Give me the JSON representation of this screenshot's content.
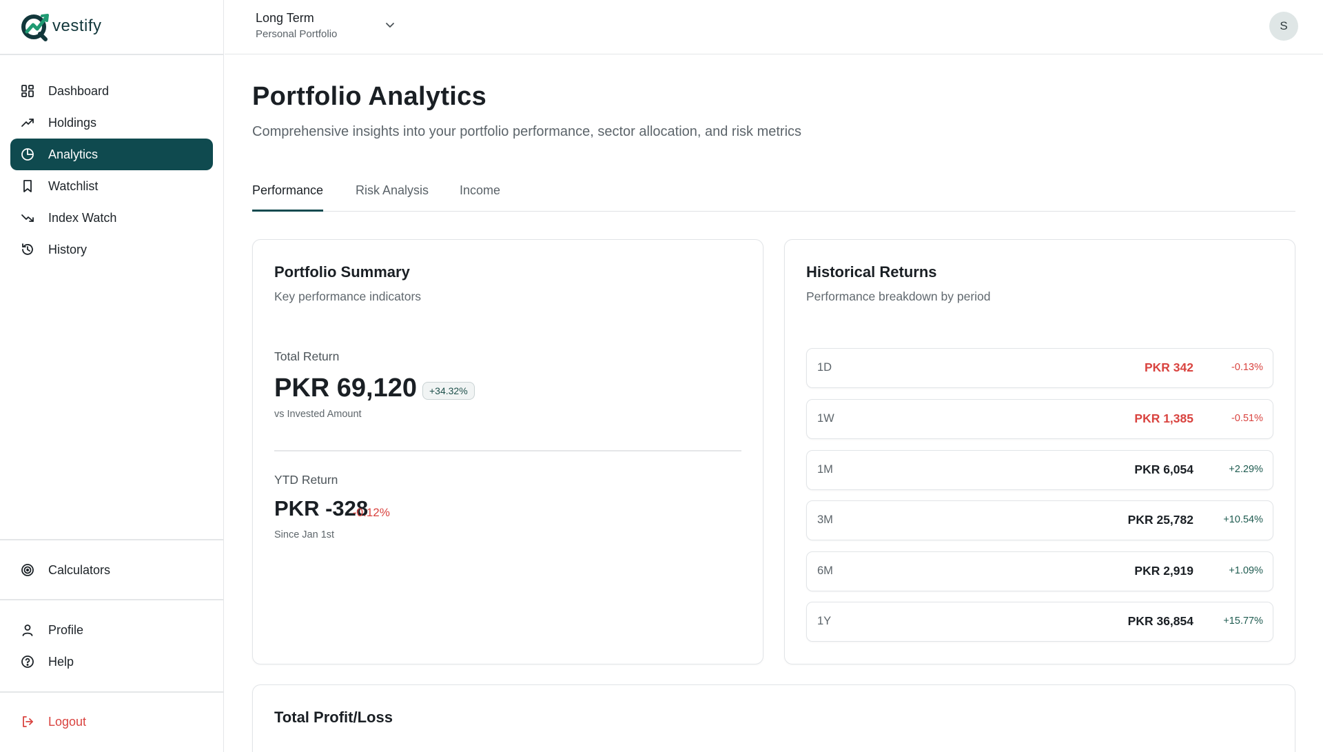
{
  "brand": {
    "name": "vestify",
    "primary": "#0f4a4f",
    "negative": "#d9433f",
    "positive": "#1d5a4f"
  },
  "sidebar": {
    "main_items": [
      {
        "label": "Dashboard",
        "icon": "dashboard-icon"
      },
      {
        "label": "Holdings",
        "icon": "trending-up-icon"
      },
      {
        "label": "Analytics",
        "icon": "pie-chart-icon",
        "active": true
      },
      {
        "label": "Watchlist",
        "icon": "bookmark-icon"
      },
      {
        "label": "Index Watch",
        "icon": "trending-down-icon"
      },
      {
        "label": "History",
        "icon": "history-icon"
      }
    ],
    "tools_items": [
      {
        "label": "Calculators",
        "icon": "target-icon"
      }
    ],
    "account_items": [
      {
        "label": "Profile",
        "icon": "user-icon"
      },
      {
        "label": "Help",
        "icon": "help-circle-icon"
      }
    ],
    "logout": {
      "label": "Logout",
      "icon": "logout-icon"
    }
  },
  "header": {
    "portfolio_name": "Long Term",
    "portfolio_type": "Personal Portfolio",
    "avatar_initial": "S"
  },
  "page": {
    "title": "Portfolio Analytics",
    "subtitle": "Comprehensive insights into your portfolio performance, sector allocation, and risk metrics",
    "tabs": [
      {
        "label": "Performance",
        "active": true
      },
      {
        "label": "Risk Analysis"
      },
      {
        "label": "Income"
      }
    ]
  },
  "summary": {
    "title": "Portfolio Summary",
    "subtitle": "Key performance indicators",
    "total_return": {
      "label": "Total Return",
      "value": "PKR 69,120",
      "pct": "+34.32%",
      "note": "vs Invested Amount"
    },
    "ytd_return": {
      "label": "YTD Return",
      "value": "PKR -328",
      "pct": "-0.12%",
      "note": "Since Jan 1st"
    }
  },
  "historical": {
    "title": "Historical Returns",
    "subtitle": "Performance breakdown by period",
    "rows": [
      {
        "period": "1D",
        "amount": "PKR 342",
        "pct": "-0.13%",
        "negative": true
      },
      {
        "period": "1W",
        "amount": "PKR 1,385",
        "pct": "-0.51%",
        "negative": true
      },
      {
        "period": "1M",
        "amount": "PKR 6,054",
        "pct": "+2.29%",
        "negative": false
      },
      {
        "period": "3M",
        "amount": "PKR 25,782",
        "pct": "+10.54%",
        "negative": false
      },
      {
        "period": "6M",
        "amount": "PKR 2,919",
        "pct": "+1.09%",
        "negative": false
      },
      {
        "period": "1Y",
        "amount": "PKR 36,854",
        "pct": "+15.77%",
        "negative": false
      }
    ]
  },
  "profit_loss": {
    "title": "Total Profit/Loss"
  }
}
